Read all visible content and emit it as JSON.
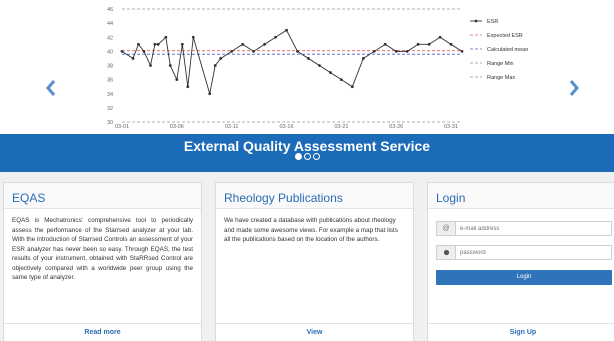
{
  "carousel": {
    "banner_title": "External Quality Assessment Service",
    "slide_count": 3,
    "active_slide": 1,
    "accent_color": "#1b6bb8"
  },
  "chart_data": {
    "type": "line",
    "x_ticks": [
      "03-01",
      "03-06",
      "03-11",
      "03-16",
      "03-21",
      "03-26",
      "03-31"
    ],
    "y_ticks": [
      30,
      32,
      34,
      36,
      38,
      40,
      42,
      44,
      46
    ],
    "ylim": [
      30,
      46
    ],
    "xlim": [
      1,
      32
    ],
    "legend_position": "right",
    "series": [
      {
        "name": "ESR",
        "x": [
          1,
          2,
          2.5,
          3,
          3.6,
          4,
          4.3,
          5,
          5.4,
          6,
          6.5,
          7,
          7.5,
          9,
          9.5,
          10,
          11,
          12,
          13,
          14,
          15,
          16,
          17,
          18,
          19,
          20,
          21,
          22,
          23,
          24,
          25,
          26,
          27,
          28,
          29,
          30,
          31,
          32
        ],
        "values": [
          40,
          39,
          41,
          40,
          38,
          41,
          41,
          42,
          38,
          36,
          41,
          35,
          42,
          34,
          38,
          39,
          40,
          41,
          40,
          41,
          42,
          43,
          40,
          39,
          38,
          37,
          36,
          35,
          39,
          40,
          41,
          40,
          40,
          41,
          41,
          42,
          41,
          40
        ],
        "color": "#333333"
      },
      {
        "name": "Expected ESR",
        "values": [
          40.1
        ],
        "color": "#e05a6a",
        "style": "dashed"
      },
      {
        "name": "Calculated mean",
        "values": [
          39.6
        ],
        "color": "#4a5bd0",
        "style": "dashed"
      },
      {
        "name": "Range Min",
        "values": [
          30
        ],
        "color": "#999999",
        "style": "dashed"
      },
      {
        "name": "Range Max",
        "values": [
          46
        ],
        "color": "#999999",
        "style": "dashed"
      }
    ]
  },
  "eqas": {
    "title": "EQAS",
    "body": "EQAS is Mechatronics' comprehensive tool to periodically assess the performance of the Starrsed analyzer at your lab. With the introduction of Starrsed Controls an assessment of your ESR analyzer has never been so easy. Through EQAS, the test results of your instrument, obtained with StaRRsed Control are objectively compared with a worldwide peer group using the same type of analyzer.",
    "footer": "Read more"
  },
  "rheology": {
    "title": "Rheology Publications",
    "body": "We have created a database with publications about rheology and made some awesome views. For example a map that lists all the publications based on the location of the authors.",
    "footer": "View"
  },
  "login": {
    "title": "Login",
    "email_placeholder": "e-mail address",
    "password_placeholder": "password",
    "button": "Login",
    "footer": "Sign Up",
    "email_icon": "at-icon",
    "password_icon": "key-icon"
  }
}
